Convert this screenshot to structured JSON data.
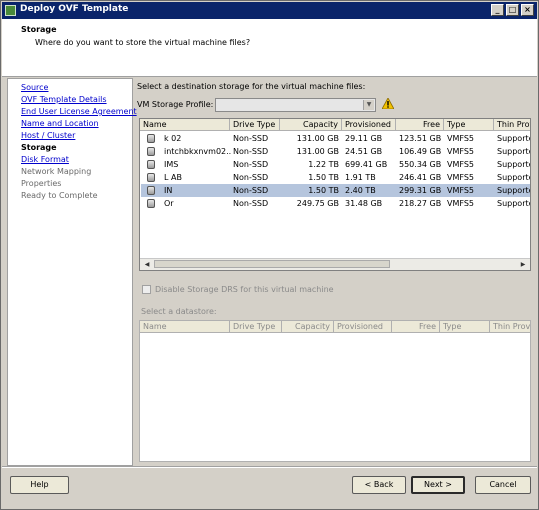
{
  "window": {
    "title": "Deploy OVF Template"
  },
  "header": {
    "title": "Storage",
    "subtitle": "Where do you want to store the virtual machine files?"
  },
  "steps": [
    {
      "label": "Source",
      "state": "link"
    },
    {
      "label": "OVF Template Details",
      "state": "link"
    },
    {
      "label": "End User License Agreement",
      "state": "link"
    },
    {
      "label": "Name and Location",
      "state": "link"
    },
    {
      "label": "Host / Cluster",
      "state": "link"
    },
    {
      "label": "Storage",
      "state": "current"
    },
    {
      "label": "Disk Format",
      "state": "link"
    },
    {
      "label": "Network Mapping",
      "state": "disabled"
    },
    {
      "label": "Properties",
      "state": "disabled"
    },
    {
      "label": "Ready to Complete",
      "state": "disabled"
    }
  ],
  "main": {
    "instruction": "Select a destination storage for the virtual machine files:",
    "profile_label": "VM Storage Profile:",
    "profile_value": "",
    "columns": [
      "Name",
      "Drive Type",
      "Capacity",
      "Provisioned",
      "Free",
      "Type",
      "Thin Provi"
    ],
    "rows": [
      {
        "name": "k          02",
        "drive": "Non-SSD",
        "capacity": "131.00 GB",
        "provisioned": "29.11 GB",
        "free": "123.51 GB",
        "type": "VMFS5",
        "thin": "Supporte",
        "selected": false
      },
      {
        "name": "intchbkxnvm02...",
        "drive": "Non-SSD",
        "capacity": "131.00 GB",
        "provisioned": "24.51 GB",
        "free": "106.49 GB",
        "type": "VMFS5",
        "thin": "Supporte",
        "selected": false
      },
      {
        "name": "IMS",
        "drive": "Non-SSD",
        "capacity": "1.22 TB",
        "provisioned": "699.41 GB",
        "free": "550.34 GB",
        "type": "VMFS5",
        "thin": "Supporte",
        "selected": false
      },
      {
        "name": "L    AB",
        "drive": "Non-SSD",
        "capacity": "1.50 TB",
        "provisioned": "1.91 TB",
        "free": "246.41 GB",
        "type": "VMFS5",
        "thin": "Supporte",
        "selected": false
      },
      {
        "name": "IN",
        "drive": "Non-SSD",
        "capacity": "1.50 TB",
        "provisioned": "2.40 TB",
        "free": "299.31 GB",
        "type": "VMFS5",
        "thin": "Supporte",
        "selected": true
      },
      {
        "name": "Or",
        "drive": "Non-SSD",
        "capacity": "249.75 GB",
        "provisioned": "31.48 GB",
        "free": "218.27 GB",
        "type": "VMFS5",
        "thin": "Supporte",
        "selected": false
      }
    ],
    "sdrs_label": "Disable Storage DRS for this virtual machine",
    "datastore_label": "Select a datastore:",
    "ds_columns": [
      "Name",
      "Drive Type",
      "Capacity",
      "Provisioned",
      "Free",
      "Type",
      "Thin Provis"
    ]
  },
  "buttons": {
    "help": "Help",
    "back": "< Back",
    "next": "Next >",
    "cancel": "Cancel"
  }
}
